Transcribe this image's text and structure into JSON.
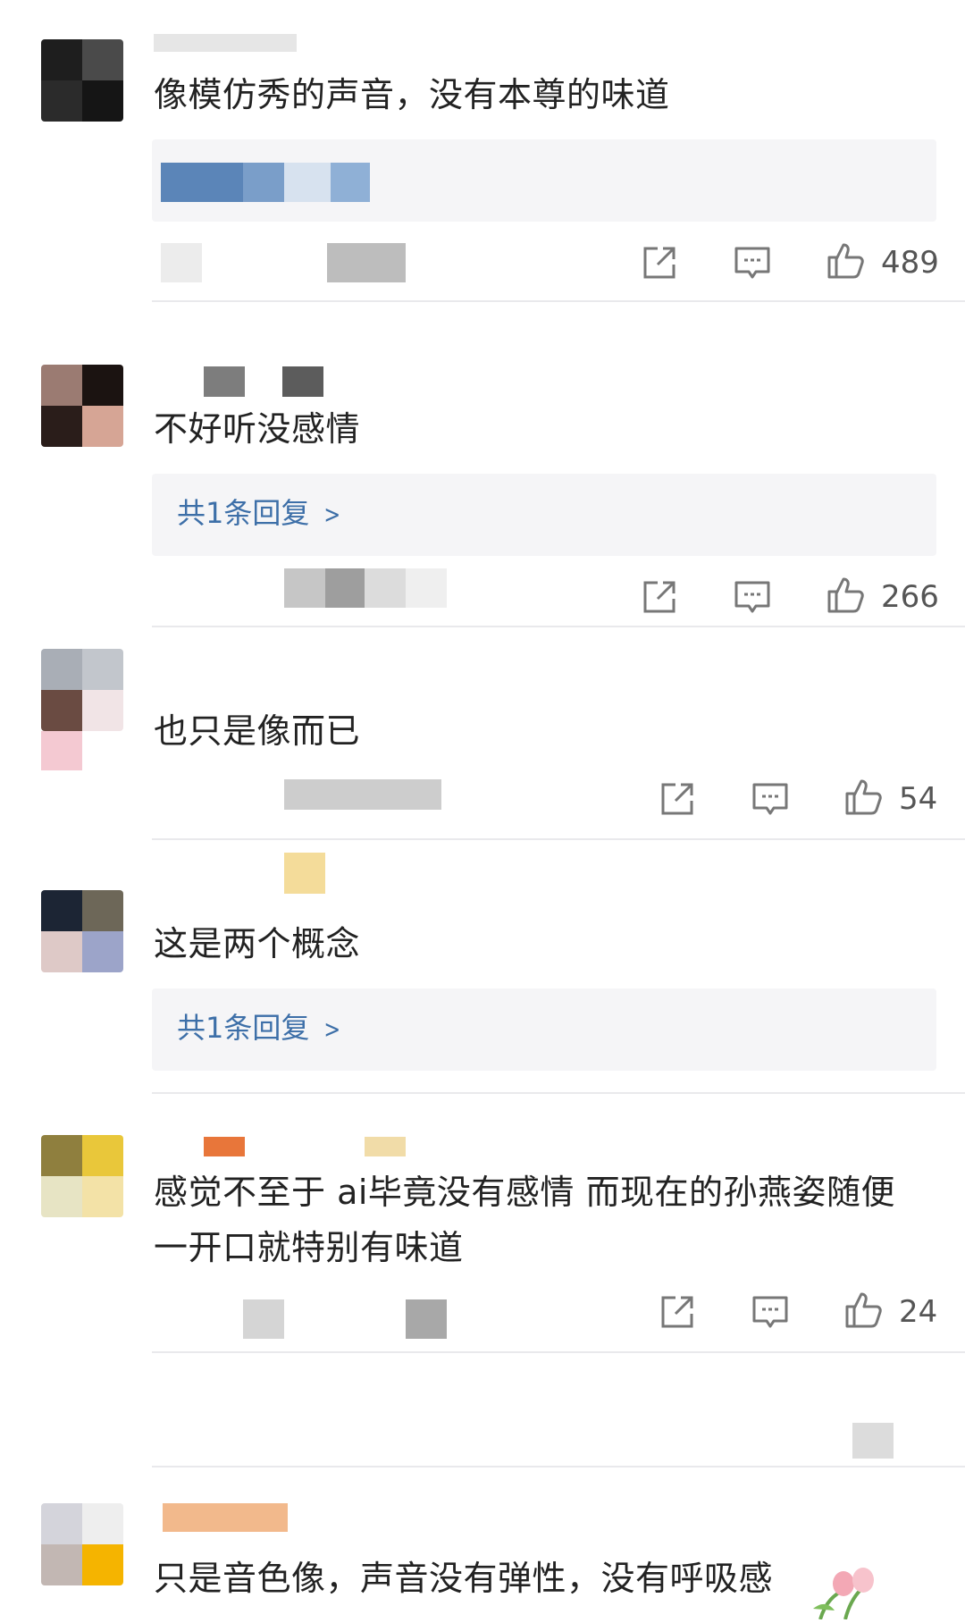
{
  "comments": [
    {
      "text": "像模仿秀的声音，没有本尊的味道",
      "reply_label": "",
      "like_count": "489"
    },
    {
      "text": "不好听没感情",
      "reply_label": "共1条回复",
      "like_count": "266"
    },
    {
      "text": "也只是像而已",
      "reply_label": "",
      "like_count": "54"
    },
    {
      "text": "这是两个概念",
      "reply_label": "共1条回复",
      "like_count": ""
    },
    {
      "text_line1": "感觉不至于 ai毕竟没有感情 而现在的孙燕姿随便",
      "text_line2": "一开口就特别有味道",
      "like_count": "24"
    },
    {
      "text": "只是音色像，声音没有弹性，没有呼吸感",
      "like_count": ""
    }
  ],
  "icons": {
    "share": "share-icon",
    "comment": "comment-icon",
    "like": "thumbs-up-icon",
    "chevron": "chevron-right-icon"
  },
  "colors": {
    "link": "#3d6fa8",
    "divider": "#e9e9ec",
    "reply_bg": "#f5f5f7"
  }
}
